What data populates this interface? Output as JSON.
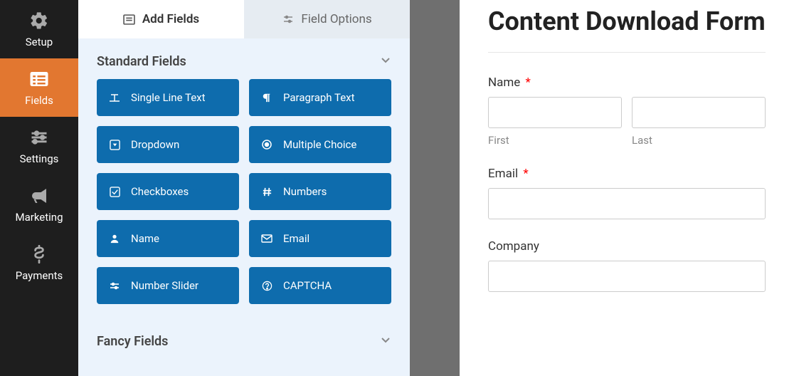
{
  "sidebar": {
    "items": [
      {
        "label": "Setup",
        "icon": "gear-icon",
        "active": false
      },
      {
        "label": "Fields",
        "icon": "list-icon",
        "active": true
      },
      {
        "label": "Settings",
        "icon": "sliders-icon",
        "active": false
      },
      {
        "label": "Marketing",
        "icon": "bullhorn-icon",
        "active": false
      },
      {
        "label": "Payments",
        "icon": "dollar-icon",
        "active": false
      }
    ]
  },
  "panel": {
    "tabs": [
      {
        "label": "Add Fields",
        "icon": "form-icon",
        "active": true
      },
      {
        "label": "Field Options",
        "icon": "sliders-icon",
        "active": false
      }
    ],
    "sections": [
      {
        "label": "Standard Fields",
        "expanded": true
      },
      {
        "label": "Fancy Fields",
        "expanded": false
      }
    ],
    "standard_fields": [
      {
        "label": "Single Line Text",
        "icon": "text-icon"
      },
      {
        "label": "Paragraph Text",
        "icon": "paragraph-icon"
      },
      {
        "label": "Dropdown",
        "icon": "caret-square-icon"
      },
      {
        "label": "Multiple Choice",
        "icon": "radio-icon"
      },
      {
        "label": "Checkboxes",
        "icon": "check-square-icon"
      },
      {
        "label": "Numbers",
        "icon": "hash-icon"
      },
      {
        "label": "Name",
        "icon": "person-icon"
      },
      {
        "label": "Email",
        "icon": "envelope-icon"
      },
      {
        "label": "Number Slider",
        "icon": "slider-icon"
      },
      {
        "label": "CAPTCHA",
        "icon": "question-circle-icon"
      }
    ]
  },
  "preview": {
    "title": "Content Download Form",
    "fields": {
      "name": {
        "label": "Name",
        "required": true,
        "first_sublabel": "First",
        "last_sublabel": "Last"
      },
      "email": {
        "label": "Email",
        "required": true
      },
      "company": {
        "label": "Company",
        "required": false
      }
    }
  }
}
